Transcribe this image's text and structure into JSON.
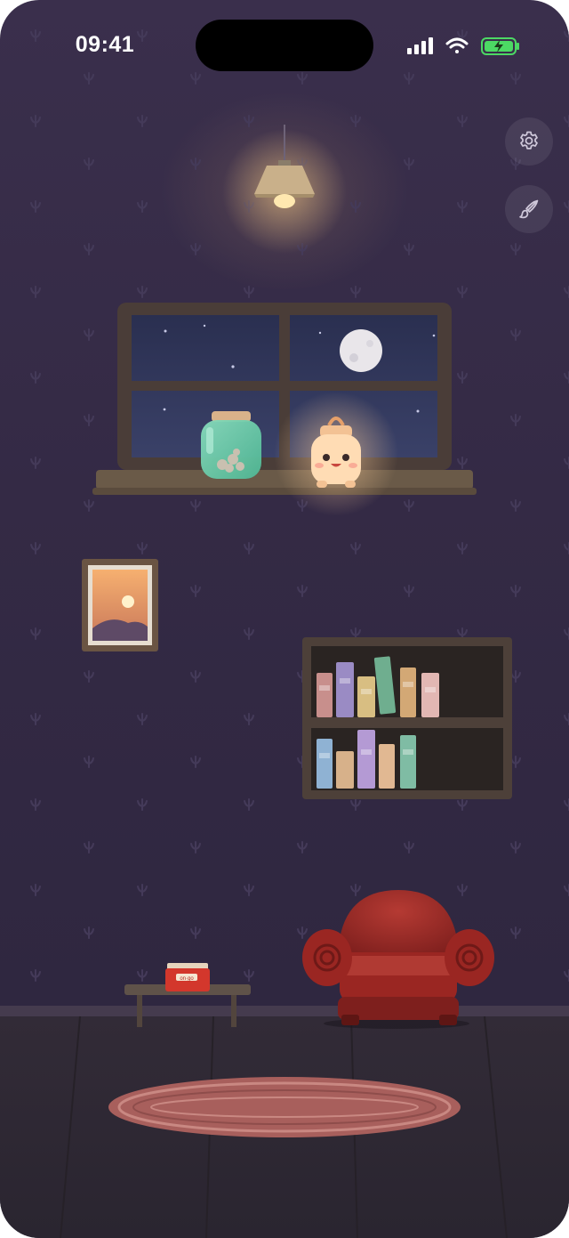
{
  "status_bar": {
    "time": "09:41",
    "battery_state": "charging",
    "battery_color": "#4cd964",
    "signal_icon": "cellular-signal-icon",
    "wifi_icon": "wifi-icon"
  },
  "controls": {
    "settings_icon": "gear-icon",
    "customize_icon": "paintbrush-icon"
  },
  "room": {
    "wall_color": "#342a45",
    "floor_color": "#2e2834",
    "radio_label": "on·go",
    "items": [
      "hanging-lamp",
      "night-window",
      "moon",
      "glass-jar",
      "lantern-character",
      "framed-sunset-picture",
      "bookshelf",
      "red-armchair",
      "side-table",
      "red-radio",
      "oval-rug"
    ]
  }
}
